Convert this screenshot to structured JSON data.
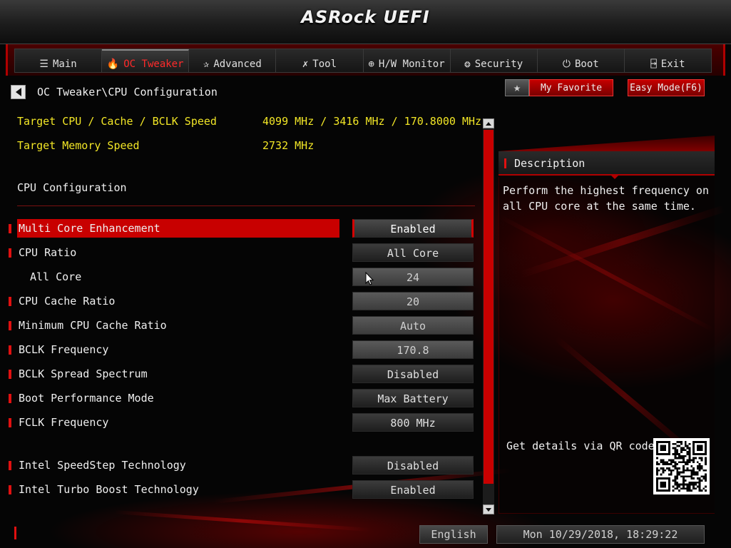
{
  "header": {
    "logo": "ASRock UEFI"
  },
  "tabs": [
    {
      "label": "Main",
      "icon": "list-icon",
      "glyph": "☰",
      "active": false
    },
    {
      "label": "OC Tweaker",
      "icon": "flame-icon",
      "glyph": "🔥",
      "active": true
    },
    {
      "label": "Advanced",
      "icon": "star-icon",
      "glyph": "✰",
      "active": false
    },
    {
      "label": "Tool",
      "icon": "tools-icon",
      "glyph": "✗",
      "active": false
    },
    {
      "label": "H/W Monitor",
      "icon": "monitor-icon",
      "glyph": "⊕",
      "active": false
    },
    {
      "label": "Security",
      "icon": "shield-icon",
      "glyph": "❂",
      "active": false
    },
    {
      "label": "Boot",
      "icon": "power-icon",
      "glyph": "⏻",
      "active": false
    },
    {
      "label": "Exit",
      "icon": "exit-icon",
      "glyph": "⍈",
      "active": false
    }
  ],
  "breadcrumb": "OC Tweaker\\CPU Configuration",
  "buttons": {
    "favorite": "My Favorite",
    "easy_mode": "Easy Mode(F6)",
    "favorite_star": "★"
  },
  "targets": [
    {
      "label": "Target CPU / Cache / BCLK Speed",
      "value": "4099 MHz / 3416 MHz / 170.8000 MHz"
    },
    {
      "label": "Target Memory Speed",
      "value": "2732 MHz"
    }
  ],
  "section_title": "CPU Configuration",
  "settings": [
    {
      "label": "Multi Core Enhancement",
      "value": "Enabled",
      "kind": "select",
      "selected": true,
      "indent": false
    },
    {
      "label": "CPU Ratio",
      "value": "All Core",
      "kind": "select",
      "selected": false,
      "indent": false
    },
    {
      "label": "All Core",
      "value": "24",
      "kind": "field",
      "selected": false,
      "indent": true,
      "nomark": true
    },
    {
      "label": "CPU Cache Ratio",
      "value": "20",
      "kind": "field",
      "selected": false,
      "indent": false
    },
    {
      "label": "Minimum CPU Cache Ratio",
      "value": "Auto",
      "kind": "field",
      "selected": false,
      "indent": false
    },
    {
      "label": "BCLK Frequency",
      "value": "170.8",
      "kind": "field",
      "selected": false,
      "indent": false
    },
    {
      "label": "BCLK Spread Spectrum",
      "value": "Disabled",
      "kind": "select",
      "selected": false,
      "indent": false
    },
    {
      "label": "Boot Performance Mode",
      "value": "Max Battery",
      "kind": "select",
      "selected": false,
      "indent": false
    },
    {
      "label": "FCLK Frequency",
      "value": "800 MHz",
      "kind": "select",
      "selected": false,
      "indent": false
    },
    {
      "label": "Intel SpeedStep Technology",
      "value": "Disabled",
      "kind": "select",
      "selected": false,
      "indent": false
    },
    {
      "label": "Intel Turbo Boost Technology",
      "value": "Enabled",
      "kind": "select",
      "selected": false,
      "indent": false
    }
  ],
  "description": {
    "title": "Description",
    "text": "Perform the highest frequency on all CPU core at the same time.",
    "qr_label": "Get details via QR code"
  },
  "footer": {
    "language": "English",
    "datetime": "Mon 10/29/2018, 18:29:22"
  },
  "colors": {
    "accent": "#c80000",
    "target_text": "#f2e626"
  }
}
